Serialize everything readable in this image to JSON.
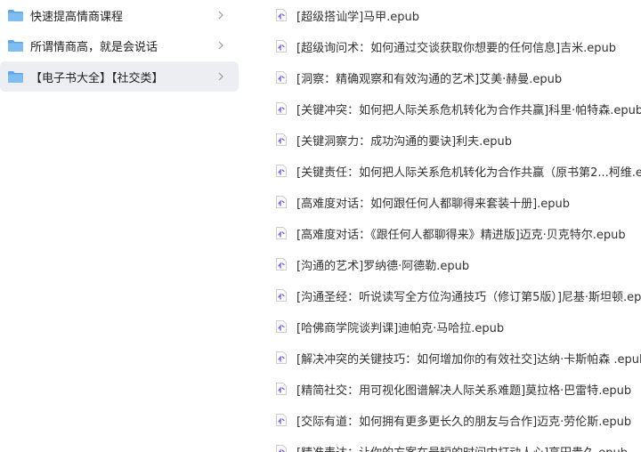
{
  "sidebar": {
    "folders": [
      {
        "label": "快速提高情商课程",
        "selected": false
      },
      {
        "label": "所谓情商高，就是会说话",
        "selected": false
      },
      {
        "label": "【电子书大全】【社交类】",
        "selected": true
      }
    ]
  },
  "file_list": {
    "files": [
      "[超级搭讪学]马甲.epub",
      "[超级询问术：如何通过交谈获取你想要的任何信息]吉米.epub",
      "[洞察：精确观察和有效沟通的艺术]艾美·赫曼.epub",
      "[关键冲突：如何把人际关系危机转化为合作共赢]科里·帕特森.epub",
      "[关键洞察力：成功沟通的要诀]利夫.epub",
      "[关键责任：如何把人际关系危机转化为合作共赢（原书第2...柯维.e",
      "[高难度对话：如何跟任何人都聊得来套装十册].epub",
      "[高难度对话：《跟任何人都聊得来》精进版]迈克·贝克特尔.epub",
      "[沟通的艺术]罗纳德·阿德勒.epub",
      "[沟通圣经：听说读写全方位沟通技巧（修订第5版）]尼基·斯坦顿.ep",
      "[哈佛商学院谈判课]迪帕克·马哈拉.epub",
      "[解决冲突的关键技巧：如何增加你的有效社交]达纳·卡斯帕森 .epub",
      "[精简社交：用可视化图谱解决人际关系难题]莫拉格·巴雷特.epub",
      "[交际有道：如何拥有更多更长久的朋友与合作]迈克·劳伦斯.epub",
      "[精准表达：让你的方案在最短的时间内打动人心]高田贵久.epub"
    ]
  },
  "colors": {
    "folder": "#5aa7ea",
    "folder_tab": "#7fbcf0",
    "file_icon_accent": "#7a5cf0",
    "selected_bg": "#eceef1"
  },
  "icons": {
    "folder": "folder-icon",
    "file": "epub-file-icon",
    "chevron": "chevron-right-icon"
  }
}
